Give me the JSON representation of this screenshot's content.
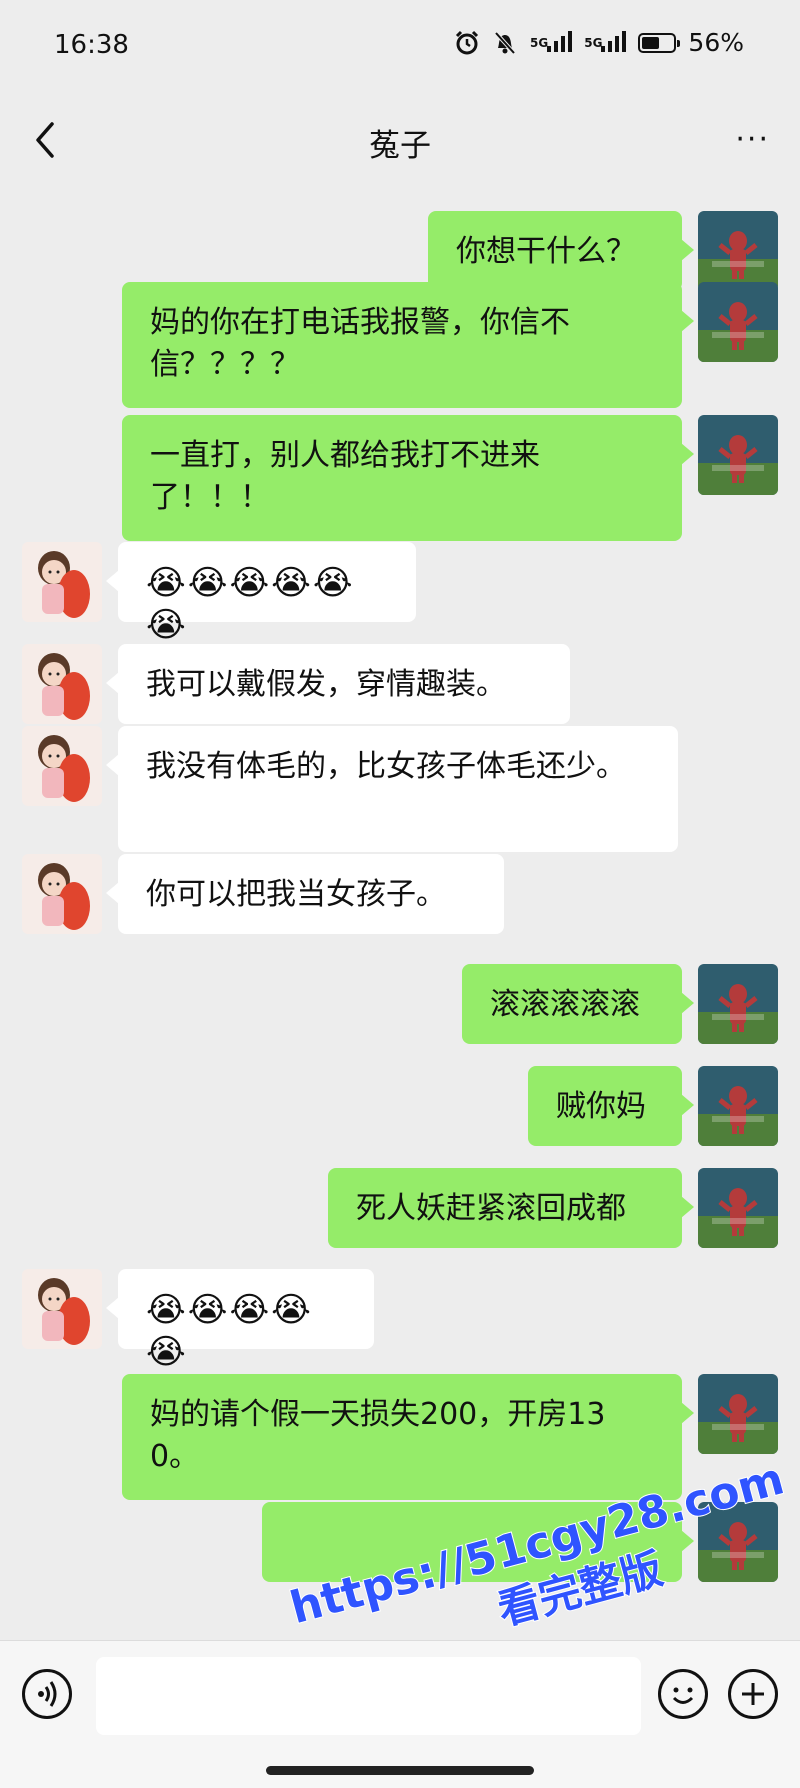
{
  "status_bar": {
    "time": "16:38",
    "network1": "5G",
    "network2": "5G",
    "battery_percent": "56%",
    "battery_level": 0.56
  },
  "nav": {
    "title": "菟子",
    "more": "···"
  },
  "messages": [
    {
      "from": "me",
      "text": "你想干什么？"
    },
    {
      "from": "me",
      "text": "妈的你在打电话我报警，你信不信？？？？"
    },
    {
      "from": "me",
      "text": "一直打，别人都给我打不进来了！！！"
    },
    {
      "from": "them",
      "text": "😭😭😭😭😭😭"
    },
    {
      "from": "them",
      "text": "我可以戴假发，穿情趣装。"
    },
    {
      "from": "them",
      "text": "我没有体毛的，比女孩子体毛还少。"
    },
    {
      "from": "them",
      "text": "你可以把我当女孩子。"
    },
    {
      "from": "me",
      "text": "滚滚滚滚滚"
    },
    {
      "from": "me",
      "text": "贼你妈"
    },
    {
      "from": "me",
      "text": "死人妖赶紧滚回成都"
    },
    {
      "from": "them",
      "text": "😭😭😭😭😭"
    },
    {
      "from": "me",
      "text": "妈的请个假一天损失200，开房130。"
    },
    {
      "from": "me",
      "text": ""
    }
  ],
  "watermark": {
    "line1": "https://51cgy28.com",
    "line2": "看完整版"
  },
  "colors": {
    "my_bubble": "#95ec69",
    "their_bubble": "#ffffff",
    "background": "#ededed",
    "watermark": "#2f54ff"
  }
}
